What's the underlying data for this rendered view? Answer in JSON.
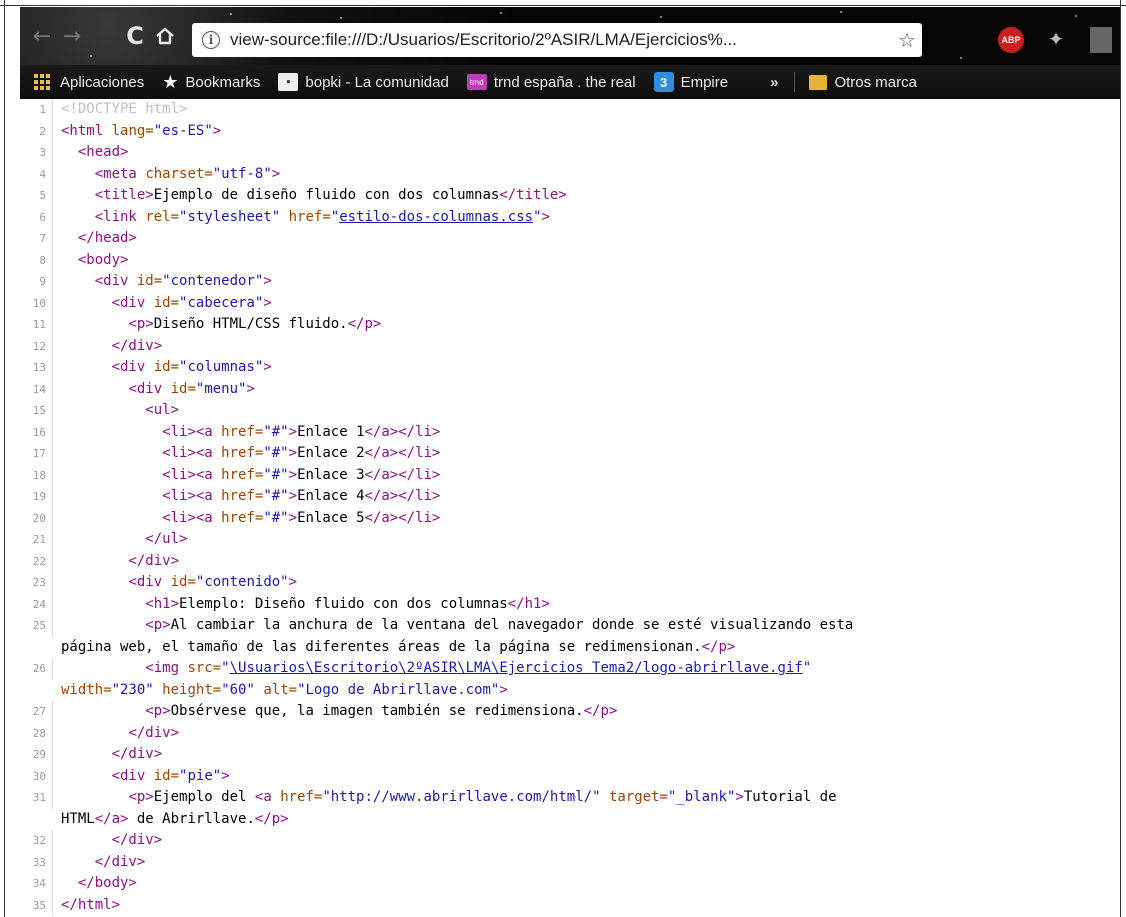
{
  "browser": {
    "url": "view-source:file:///D:/Usuarios/Escritorio/2ºASIR/LMA/Ejercicios%...",
    "extension_abp_label": "ABP"
  },
  "bookmarks": [
    {
      "label": "Aplicaciones",
      "icon": "apps-grid-icon"
    },
    {
      "label": "Bookmarks",
      "icon": "star-icon"
    },
    {
      "label": "bopki - La comunidad",
      "icon": "bopki-icon"
    },
    {
      "label": "trnd españa . the real",
      "icon": "trnd-icon"
    },
    {
      "label": "Empire",
      "icon": "empire-3-icon"
    },
    {
      "label": "Otros marca",
      "icon": "folder-icon"
    }
  ],
  "source_lines": [
    {
      "n": "1",
      "html": "<span class='doctype'>&lt;!DOCTYPE html&gt;</span>"
    },
    {
      "n": "2",
      "html": "<span class='tag'>&lt;html</span> <span class='attr'>lang=</span><span class='val'>\"es-ES\"</span><span class='tag'>&gt;</span>"
    },
    {
      "n": "3",
      "html": "  <span class='tag'>&lt;head&gt;</span>"
    },
    {
      "n": "4",
      "html": "    <span class='tag'>&lt;meta</span> <span class='attr'>charset=</span><span class='val'>\"utf-8\"</span><span class='tag'>&gt;</span>"
    },
    {
      "n": "5",
      "html": "    <span class='tag'>&lt;title&gt;</span>Ejemplo de diseño fluido con dos columnas<span class='tag'>&lt;/title&gt;</span>"
    },
    {
      "n": "6",
      "html": "    <span class='tag'>&lt;link</span> <span class='attr'>rel=</span><span class='val'>\"stylesheet\"</span> <span class='attr'>href=</span><span class='val'>\"<a class='link'>estilo-dos-columnas.css</a>\"</span><span class='tag'>&gt;</span>"
    },
    {
      "n": "7",
      "html": "  <span class='tag'>&lt;/head&gt;</span>"
    },
    {
      "n": "8",
      "html": "  <span class='tag'>&lt;body&gt;</span>"
    },
    {
      "n": "9",
      "html": "    <span class='tag'>&lt;div</span> <span class='attr'>id=</span><span class='val'>\"contenedor\"</span><span class='tag'>&gt;</span>"
    },
    {
      "n": "10",
      "html": "      <span class='tag'>&lt;div</span> <span class='attr'>id=</span><span class='val'>\"cabecera\"</span><span class='tag'>&gt;</span>"
    },
    {
      "n": "11",
      "html": "        <span class='tag'>&lt;p&gt;</span>Diseño HTML/CSS fluido.<span class='tag'>&lt;/p&gt;</span>"
    },
    {
      "n": "12",
      "html": "      <span class='tag'>&lt;/div&gt;</span>"
    },
    {
      "n": "13",
      "html": "      <span class='tag'>&lt;div</span> <span class='attr'>id=</span><span class='val'>\"columnas\"</span><span class='tag'>&gt;</span>"
    },
    {
      "n": "14",
      "html": "        <span class='tag'>&lt;div</span> <span class='attr'>id=</span><span class='val'>\"menu\"</span><span class='tag'>&gt;</span>"
    },
    {
      "n": "15",
      "html": "          <span class='tag'>&lt;ul&gt;</span>"
    },
    {
      "n": "16",
      "html": "            <span class='tag'>&lt;li&gt;&lt;a</span> <span class='attr'>href=</span><span class='val'>\"#\"</span><span class='tag'>&gt;</span>Enlace 1<span class='tag'>&lt;/a&gt;&lt;/li&gt;</span>"
    },
    {
      "n": "17",
      "html": "            <span class='tag'>&lt;li&gt;&lt;a</span> <span class='attr'>href=</span><span class='val'>\"#\"</span><span class='tag'>&gt;</span>Enlace 2<span class='tag'>&lt;/a&gt;&lt;/li&gt;</span>"
    },
    {
      "n": "18",
      "html": "            <span class='tag'>&lt;li&gt;&lt;a</span> <span class='attr'>href=</span><span class='val'>\"#\"</span><span class='tag'>&gt;</span>Enlace 3<span class='tag'>&lt;/a&gt;&lt;/li&gt;</span>"
    },
    {
      "n": "19",
      "html": "            <span class='tag'>&lt;li&gt;&lt;a</span> <span class='attr'>href=</span><span class='val'>\"#\"</span><span class='tag'>&gt;</span>Enlace 4<span class='tag'>&lt;/a&gt;&lt;/li&gt;</span>"
    },
    {
      "n": "20",
      "html": "            <span class='tag'>&lt;li&gt;&lt;a</span> <span class='attr'>href=</span><span class='val'>\"#\"</span><span class='tag'>&gt;</span>Enlace 5<span class='tag'>&lt;/a&gt;&lt;/li&gt;</span>"
    },
    {
      "n": "21",
      "html": "          <span class='tag'>&lt;/ul&gt;</span>"
    },
    {
      "n": "22",
      "html": "        <span class='tag'>&lt;/div&gt;</span>"
    },
    {
      "n": "23",
      "html": "        <span class='tag'>&lt;div</span> <span class='attr'>id=</span><span class='val'>\"contenido\"</span><span class='tag'>&gt;</span>"
    },
    {
      "n": "24",
      "html": "          <span class='tag'>&lt;h1&gt;</span>Elemplo: Diseño fluido con dos columnas<span class='tag'>&lt;/h1&gt;</span>"
    },
    {
      "n": "25",
      "html": "          <span class='tag'>&lt;p&gt;</span>Al cambiar la anchura de la ventana del navegador donde se esté visualizando esta<br>página web, el tamaño de las diferentes áreas de la página se redimensionan.<span class='tag'>&lt;/p&gt;</span>"
    },
    {
      "n": "26",
      "html": "          <span class='tag'>&lt;img</span> <span class='attr'>src=</span><span class='val'>\"<a class='link'>\\Usuarios\\Escritorio\\2ºASIR\\LMA\\Ejercicios Tema2/logo-abrirllave.gif</a>\"</span><br><span class='attr'>width=</span><span class='val'>\"230\"</span> <span class='attr'>height=</span><span class='val'>\"60\"</span> <span class='attr'>alt=</span><span class='val'>\"Logo de Abrirllave.com\"</span><span class='tag'>&gt;</span>"
    },
    {
      "n": "27",
      "html": "          <span class='tag'>&lt;p&gt;</span>Obsérvese que, la imagen también se redimensiona.<span class='tag'>&lt;/p&gt;</span>"
    },
    {
      "n": "28",
      "html": "        <span class='tag'>&lt;/div&gt;</span>"
    },
    {
      "n": "29",
      "html": "      <span class='tag'>&lt;/div&gt;</span>"
    },
    {
      "n": "30",
      "html": "      <span class='tag'>&lt;div</span> <span class='attr'>id=</span><span class='val'>\"pie\"</span><span class='tag'>&gt;</span>"
    },
    {
      "n": "31",
      "html": "        <span class='tag'>&lt;p&gt;</span>Ejemplo del <span class='tag'>&lt;a</span> <span class='attr'>href=</span><span class='val'>\"http://www.abrirllave.com/html/\"</span> <span class='attr'>target=</span><span class='val'>\"_blank\"</span><span class='tag'>&gt;</span>Tutorial de<br>HTML<span class='tag'>&lt;/a&gt;</span> de Abrirllave.<span class='tag'>&lt;/p&gt;</span>"
    },
    {
      "n": "32",
      "html": "      <span class='tag'>&lt;/div&gt;</span>"
    },
    {
      "n": "33",
      "html": "    <span class='tag'>&lt;/div&gt;</span>"
    },
    {
      "n": "34",
      "html": "  <span class='tag'>&lt;/body&gt;</span>"
    },
    {
      "n": "35",
      "html": "<span class='tag'>&lt;/html&gt;</span>"
    }
  ]
}
